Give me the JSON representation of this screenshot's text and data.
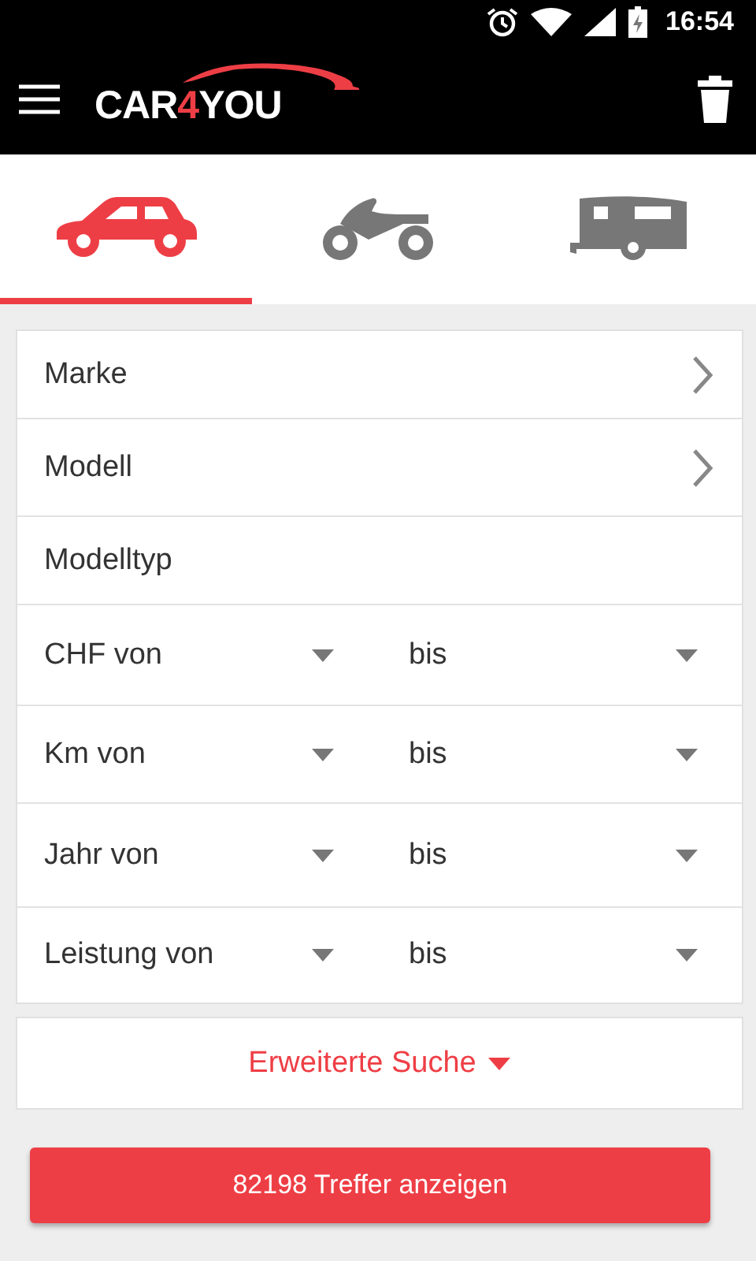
{
  "status_bar": {
    "time": "16:54"
  },
  "app_bar": {
    "logo": {
      "before": "CAR",
      "accent": "4",
      "after": "YOU"
    }
  },
  "tabs": [
    {
      "kind": "car",
      "selected": true
    },
    {
      "kind": "motorcycle",
      "selected": false
    },
    {
      "kind": "caravan",
      "selected": false
    }
  ],
  "fields": [
    {
      "kind": "select",
      "label": "Marke"
    },
    {
      "kind": "select",
      "label": "Modell"
    },
    {
      "kind": "text",
      "label": "Modelltyp"
    },
    {
      "kind": "range",
      "label": "CHF von",
      "to_label": "bis"
    },
    {
      "kind": "range",
      "label": "Km von",
      "to_label": "bis"
    },
    {
      "kind": "range",
      "label": "Jahr von",
      "to_label": "bis"
    },
    {
      "kind": "range",
      "label": "Leistung von",
      "to_label": "bis"
    }
  ],
  "advanced_search": {
    "label": "Erweiterte Suche"
  },
  "submit": {
    "label": "82198 Treffer anzeigen"
  }
}
